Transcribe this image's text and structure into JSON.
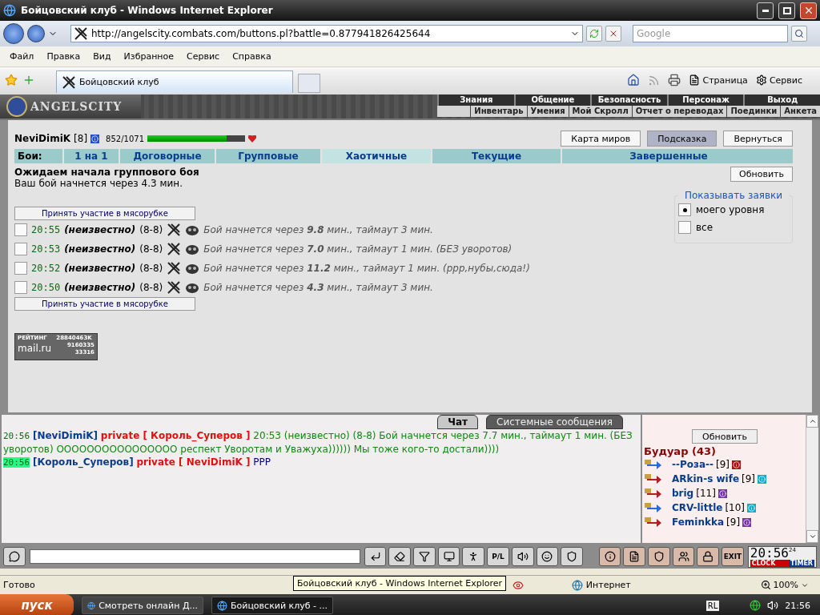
{
  "window": {
    "title": "Бойцовский клуб - Windows Internet Explorer"
  },
  "address": {
    "url": "http://angelscity.combats.com/buttons.pl?battle=0.877941826425644"
  },
  "search": {
    "placeholder": "Google"
  },
  "menu": [
    "Файл",
    "Правка",
    "Вид",
    "Избранное",
    "Сервис",
    "Справка"
  ],
  "tabs": [
    {
      "label": "Бойцовский клуб",
      "selected": true
    }
  ],
  "command_bar": [
    "Страница",
    "Сервис"
  ],
  "game": {
    "logo": "ANGELSCITY",
    "nav_top": [
      "Знания",
      "Общение",
      "Безопасность",
      "Персонаж",
      "Выход"
    ],
    "nav_bottom": [
      "Инвентарь",
      "Умения",
      "Мой Скролл",
      "Отчет о переводах",
      "Поединки",
      "Анкета"
    ],
    "player": {
      "name": "NeviDimiK",
      "level_text": "[8]",
      "hp": "852/1071",
      "level": 0.81
    },
    "buttons": [
      {
        "label": "Карта миров",
        "selected": false
      },
      {
        "label": "Подсказка",
        "selected": true
      },
      {
        "label": "Вернуться",
        "selected": false
      }
    ],
    "battles_label": "Бои:",
    "battle_tabs": [
      {
        "label": "1 на 1",
        "selected": false
      },
      {
        "label": "Договорные",
        "selected": false
      },
      {
        "label": "Групповые",
        "selected": false
      },
      {
        "label": "Хаотичные",
        "selected": true
      },
      {
        "label": "Текущие",
        "selected": false
      },
      {
        "label": "Завершенные",
        "selected": false
      }
    ],
    "status": {
      "title": "Ожидаем начала группового боя",
      "subtitle": "Ваш бой начнется через 4.3 мин.",
      "refresh": "Обновить"
    },
    "filter": {
      "legend": "Показывать заявки",
      "options": [
        {
          "label": "моего уровня",
          "selected": true
        },
        {
          "label": "все",
          "selected": false
        }
      ]
    },
    "join_button": "Принять участие в мясорубке",
    "join_button_bottom": "Принять участие в мясорубке",
    "requests": [
      {
        "time": "20:55",
        "who": "(неизвестно)",
        "teams": "(8-8)",
        "text": "Бой начнется через **9.8** мин., таймаут 3 мин.",
        "selected": false
      },
      {
        "time": "20:53",
        "who": "(неизвестно)",
        "teams": "(8-8)",
        "text": "Бой начнется через **7.0** мин., таймаут 1 мин. (БЕЗ уворотов)",
        "selected": false
      },
      {
        "time": "20:52",
        "who": "(неизвестно)",
        "teams": "(8-8)",
        "text": "Бой начнется через **11.2** мин., таймаут 1 мин. (ррр,нубы,сюда!)",
        "selected": false
      },
      {
        "time": "20:50",
        "who": "(неизвестно)",
        "teams": "(8-8)",
        "text": "Бой начнется через **4.3** мин., таймаут 3 мин.",
        "selected": false
      }
    ],
    "counter": {
      "title": "РЕЙТИНГ",
      "value": "28840463K",
      "brand": "mail.ru",
      "line_1": "9160335",
      "line_2": "33316"
    }
  },
  "chat": {
    "tabs": [
      {
        "label": "Чат",
        "selected": true
      },
      {
        "label": "Системные сообщения",
        "selected": false
      }
    ],
    "messages": [
      {
        "time": "20:56",
        "highlight": false,
        "from": "[NeviDimiK]",
        "to": "private [ Король_Суперов ]",
        "text": "20:53 (неизвестно) (8-8) Бой начнется через 7.7 мин., таймаут 1 мин. (БЕЗ уворотов) ОООООООООООООООО респект Уворотам и Уважуха)))))) Мы тоже кого-то достали))))",
        "color": "#118811"
      },
      {
        "time": "20:56",
        "highlight": true,
        "from": "[Король_Суперов]",
        "to": "private [ NeviDimiK ]",
        "text": "PPP",
        "color": "#000080"
      }
    ]
  },
  "userlist": {
    "refresh": "Обновить",
    "room": "Будуар (43)",
    "users": [
      {
        "name": "--Роза--",
        "level_text": "[9]",
        "kind": "in",
        "color": "#aa1111"
      },
      {
        "name": "ARkin-s wife",
        "level_text": "[9]",
        "kind": "out",
        "color": "#11aacc"
      },
      {
        "name": "brig",
        "level_text": "[11]",
        "kind": "out",
        "color": "#7733aa"
      },
      {
        "name": "CRV-little",
        "level_text": "[10]",
        "kind": "in",
        "color": "#11aacc"
      },
      {
        "name": "Feminkka",
        "level_text": "[9]",
        "kind": "out",
        "color": "#7733aa"
      }
    ]
  },
  "toolbar": {
    "pl_label": "P/L",
    "exit_label": "EXIT",
    "clock": "20:56",
    "clock_mode": "24",
    "clock_label": "CLOCK",
    "timer_label": "TIMER"
  },
  "status_bar": {
    "text": "Готово",
    "zone": "Интернет",
    "zoom": "100%"
  },
  "tooltip": "Бойцовский клуб - Windows Internet Explorer",
  "taskbar": {
    "start": "пуск",
    "tasks": [
      {
        "label": "Смотреть онлайн Д...",
        "selected": false
      },
      {
        "label": "Бойцовский клуб - ...",
        "selected": true
      }
    ],
    "lang": "RL",
    "time": "21:56"
  }
}
